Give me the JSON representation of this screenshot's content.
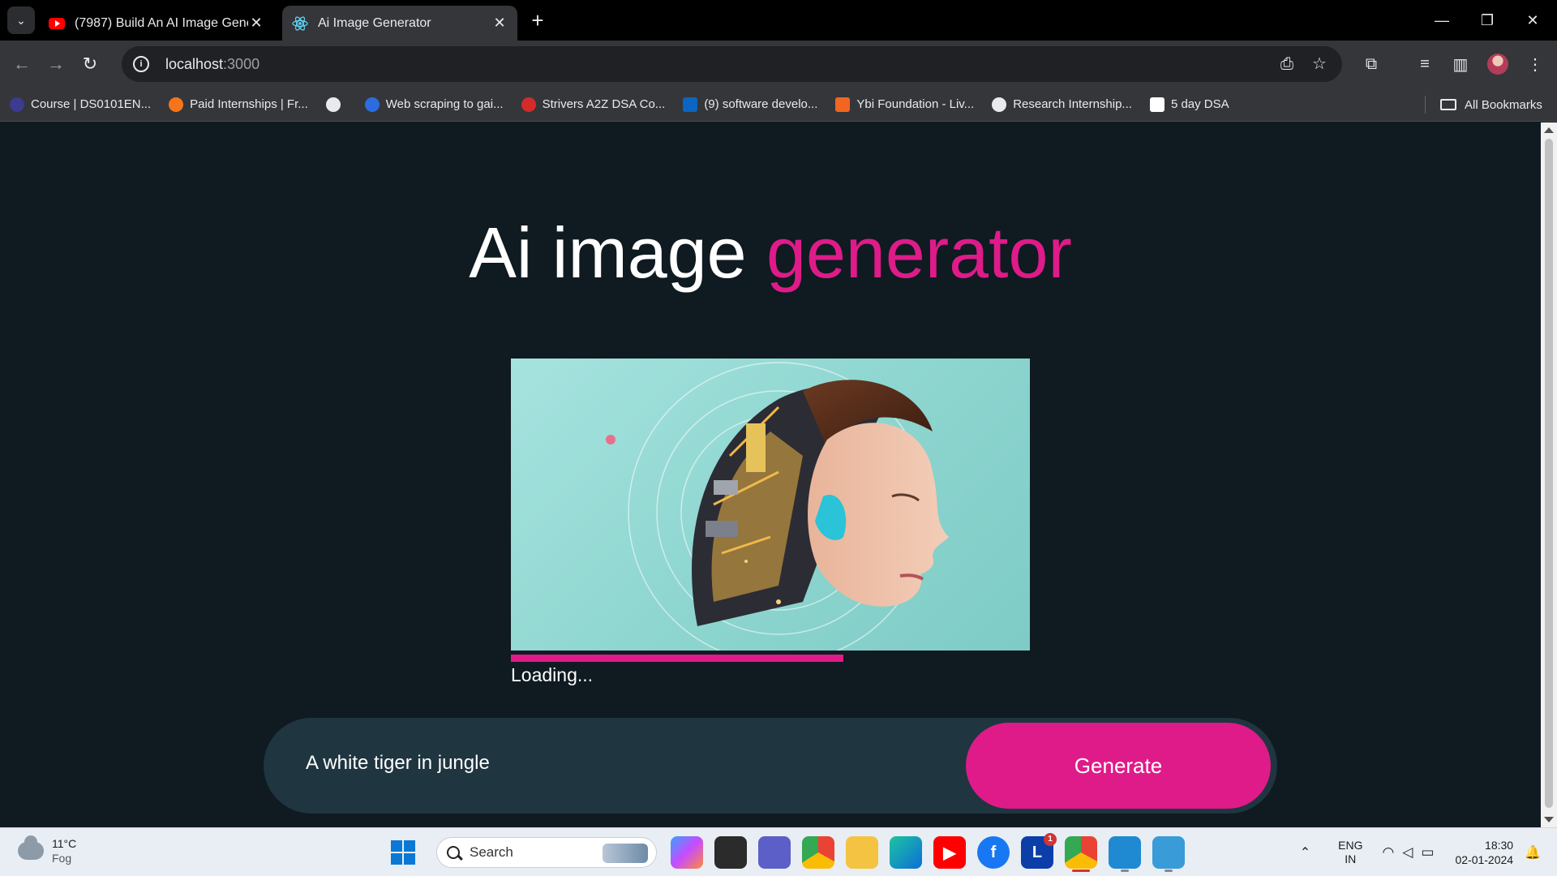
{
  "browser": {
    "tabs": [
      {
        "title": "(7987) Build An AI Image Gener",
        "favicon": "youtube-icon",
        "active": false
      },
      {
        "title": "Ai Image Generator",
        "favicon": "react-icon",
        "active": true
      }
    ],
    "new_tab": "+",
    "window_controls": {
      "minimize": "—",
      "restore": "❐",
      "close": "✕"
    },
    "toolbar": {
      "back": "←",
      "forward": "→",
      "reload": "↻"
    },
    "address": {
      "host": "localhost",
      "port": ":3000",
      "info": "i"
    },
    "bookmarks": [
      {
        "label": "Course | DS0101EN...",
        "icon_color": "#3b3b8f"
      },
      {
        "label": "Paid Internships | Fr...",
        "icon_color": "#f5751b"
      },
      {
        "label": "",
        "icon_color": "#e8eaed"
      },
      {
        "label": "Web scraping to gai...",
        "icon_color": "#2d6cdf"
      },
      {
        "label": "Strivers A2Z DSA Co...",
        "icon_color": "#d52a2a"
      },
      {
        "label": "(9) software develo...",
        "icon_color": "#0a66c2"
      },
      {
        "label": "Ybi Foundation - Liv...",
        "icon_color": "#f26522"
      },
      {
        "label": "Research Internship...",
        "icon_color": "#e8eaed"
      },
      {
        "label": "5 day DSA",
        "icon_color": "#ffffff"
      }
    ],
    "all_bookmarks": "All Bookmarks"
  },
  "app": {
    "heading_main": "Ai image ",
    "heading_accent": "generator",
    "loading_text": "Loading...",
    "progress_fraction": 0.64,
    "prompt_value": "A white tiger in jungle",
    "generate_label": "Generate"
  },
  "taskbar": {
    "weather_temp": "11°C",
    "weather_cond": "Fog",
    "search_placeholder": "Search",
    "lang_line1": "ENG",
    "lang_line2": "IN",
    "time": "18:30",
    "date": "02-01-2024",
    "notification_badge": "1"
  },
  "colors": {
    "accent": "#de1b89",
    "page_bg": "#0f1a21",
    "input_bg": "#1f3540"
  }
}
